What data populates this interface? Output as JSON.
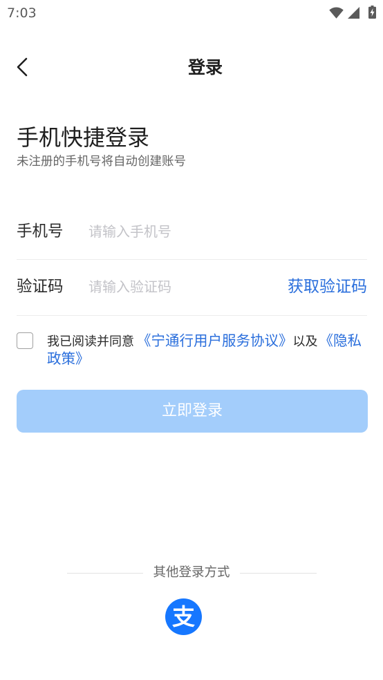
{
  "status_bar": {
    "time": "7:03",
    "icons": [
      "wifi-icon",
      "signal-icon",
      "battery-charging-icon"
    ]
  },
  "header": {
    "back_icon": "back-arrow-icon",
    "title": "登录"
  },
  "intro": {
    "heading": "手机快捷登录",
    "subheading": "未注册的手机号将自动创建账号"
  },
  "form": {
    "phone": {
      "label": "手机号",
      "placeholder": "请输入手机号",
      "value": ""
    },
    "code": {
      "label": "验证码",
      "placeholder": "请输入验证码",
      "value": "",
      "get_code_label": "获取验证码"
    }
  },
  "agreement": {
    "checked": false,
    "prefix": "我已阅读并同意",
    "terms_link": "《宁通行用户服务协议》",
    "conjunction": "以及",
    "privacy_link": "《隐私政策》"
  },
  "login_button": {
    "label": "立即登录",
    "enabled": false
  },
  "other_login": {
    "label": "其他登录方式",
    "providers": [
      {
        "icon": "alipay-icon",
        "logo_glyph": "支"
      }
    ]
  },
  "colors": {
    "background": "#ffffff",
    "text_primary": "#1f1f1f",
    "text_secondary": "#666666",
    "placeholder": "#c3c3c8",
    "accent": "#2b6fdc",
    "button_disabled": "#a3cdfb",
    "button_text": "#ffffff",
    "divider": "#ececec",
    "alipay": "#1677ff"
  }
}
